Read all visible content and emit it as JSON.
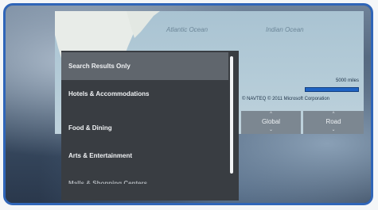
{
  "map": {
    "ocean_labels": [
      "Atlantic Ocean",
      "Indian Ocean"
    ],
    "scale_text": "5000 miles",
    "copyright": "© NAVTEQ  © 2011 Microsoft Corporation"
  },
  "nav": {
    "global_label": "Global",
    "road_label": "Road",
    "up_glyph": "^",
    "down_glyph": "⌄"
  },
  "menu": {
    "items": [
      "Search Results Only",
      "Hotels & Accommodations",
      "Food & Dining",
      "Arts & Entertainment",
      "Malls & Shopping Centers"
    ],
    "selected_index": 0
  },
  "colors": {
    "frame_border": "#2f65b8",
    "menu_bg": "#393d42",
    "menu_selected": "#60666d",
    "scale_bar": "#1f63c3"
  }
}
